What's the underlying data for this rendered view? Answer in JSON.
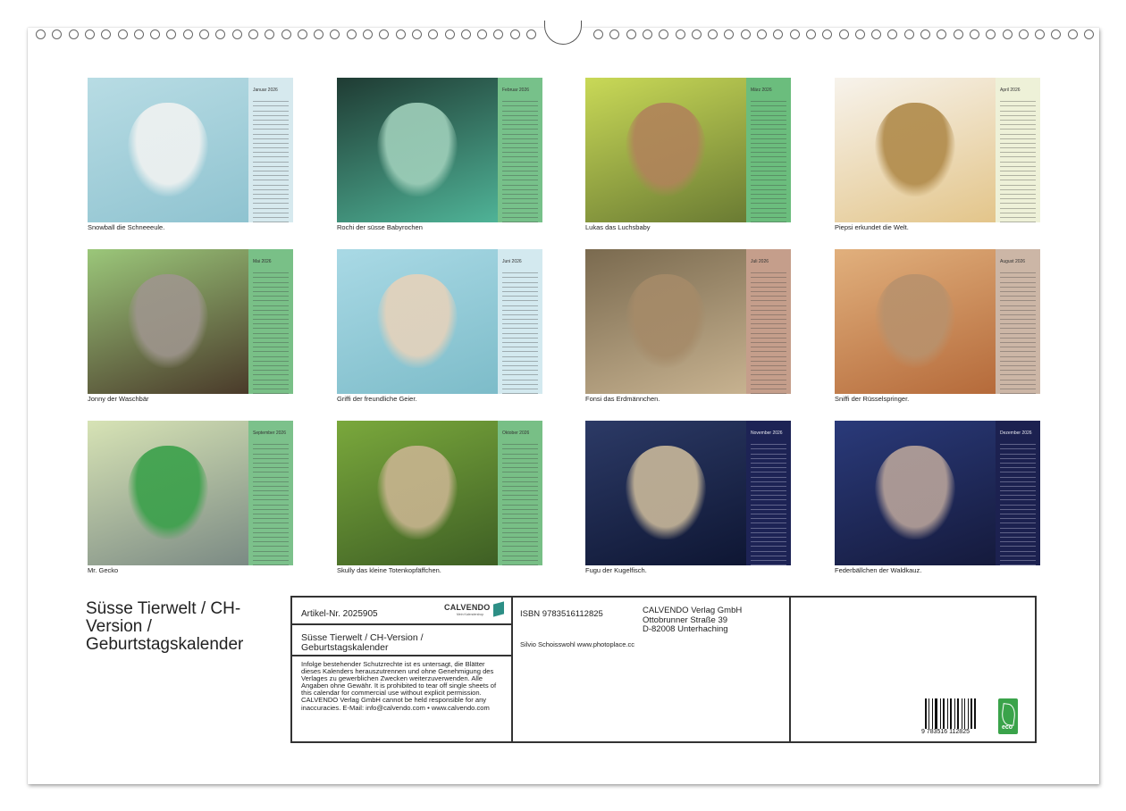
{
  "calendar_title": "Süsse Tierwelt / CH-Version / Geburtstagskalender",
  "tiles": [
    {
      "month": "Januar 2026",
      "caption": "Snowball die Schneeeule.",
      "strip_color": "#d6e9ee",
      "photo_colors": [
        "#b8dce4",
        "#8fc3d0"
      ],
      "subject_color": "#f0f2f1"
    },
    {
      "month": "Februar 2026",
      "caption": "Rochi der süsse Babyrochen",
      "strip_color": "#77c18a",
      "photo_colors": [
        "#1f3b33",
        "#4fb397"
      ],
      "subject_color": "#9fcfba"
    },
    {
      "month": "März 2026",
      "caption": "Lukas das Luchsbaby",
      "strip_color": "#6bbd7d",
      "photo_colors": [
        "#c9d957",
        "#6a7b33"
      ],
      "subject_color": "#b0835a"
    },
    {
      "month": "April 2026",
      "caption": "Piepsi erkundet die Welt.",
      "strip_color": "#eef1d8",
      "photo_colors": [
        "#f7f3ec",
        "#e3c58a"
      ],
      "subject_color": "#b08a4a"
    },
    {
      "month": "Mai 2026",
      "caption": "Jonny der Waschbär",
      "strip_color": "#79c087",
      "photo_colors": [
        "#9bc77a",
        "#4a3a2a"
      ],
      "subject_color": "#9e958d"
    },
    {
      "month": "Juni 2026",
      "caption": "Griffi der freundliche Geier.",
      "strip_color": "#d3e9ef",
      "photo_colors": [
        "#a9d9e5",
        "#7dbcc9"
      ],
      "subject_color": "#e5d2bb"
    },
    {
      "month": "Juli 2026",
      "caption": "Fonsi das Erdmännchen.",
      "strip_color": "#c59e8b",
      "photo_colors": [
        "#7a6a4f",
        "#c7b290"
      ],
      "subject_color": "#a58a68"
    },
    {
      "month": "August 2026",
      "caption": "Sniffi der Rüsselspringer.",
      "strip_color": "#ccb6a6",
      "photo_colors": [
        "#e1b07d",
        "#b56a3a"
      ],
      "subject_color": "#b8916c"
    },
    {
      "month": "September 2026",
      "caption": "Mr. Gecko",
      "strip_color": "#7cc18b",
      "photo_colors": [
        "#d7e3b5",
        "#7b8a84"
      ],
      "subject_color": "#3aa04a"
    },
    {
      "month": "Oktober 2026",
      "caption": "Skully das kleine Totenkopfäffchen.",
      "strip_color": "#78bf86",
      "photo_colors": [
        "#7aa83c",
        "#3e5f24"
      ],
      "subject_color": "#c8b48f"
    },
    {
      "month": "November 2026",
      "caption": "Fugu der Kugelfisch.",
      "strip_color": "#1d2355",
      "photo_colors": [
        "#2c3a66",
        "#0e1633"
      ],
      "subject_color": "#c9b89a"
    },
    {
      "month": "Dezember 2026",
      "caption": "Federbällchen der Waldkauz.",
      "strip_color": "#1c2150",
      "photo_colors": [
        "#2a3a7a",
        "#151a3c"
      ],
      "subject_color": "#b8a39a"
    }
  ],
  "info_panel": {
    "article_number": "Artikel-Nr. 2025905",
    "logo_word": "CALVENDO",
    "logo_tagline": "Mein Kalendershop",
    "product_title": "Süsse Tierwelt / CH-Version / Geburtstagskalender",
    "legal_text": "Infolge bestehender Schutzrechte ist es untersagt, die Blätter dieses Kalenders herauszutrennen und ohne Genehmigung des Verlages zu gewerblichen Zwecken weiterzuverwenden. Alle Angaben ohne Gewähr. It is prohibited to tear off single sheets of this calendar for commercial use without explicit permission. CALVENDO Verlag GmbH cannot be held responsible for any inaccuracies. E-Mail: info@calvendo.com • www.calvendo.com",
    "isbn": "ISBN 9783516112825",
    "publisher_name": "CALVENDO Verlag GmbH",
    "publisher_street": "Ottobrunner Straße 39",
    "publisher_city": "D-82008 Unterhaching",
    "photographer": "Silvio Schoisswohl www.photoplace.cc",
    "barcode_digits": "9 783516 112825",
    "eco_label": "eco"
  }
}
